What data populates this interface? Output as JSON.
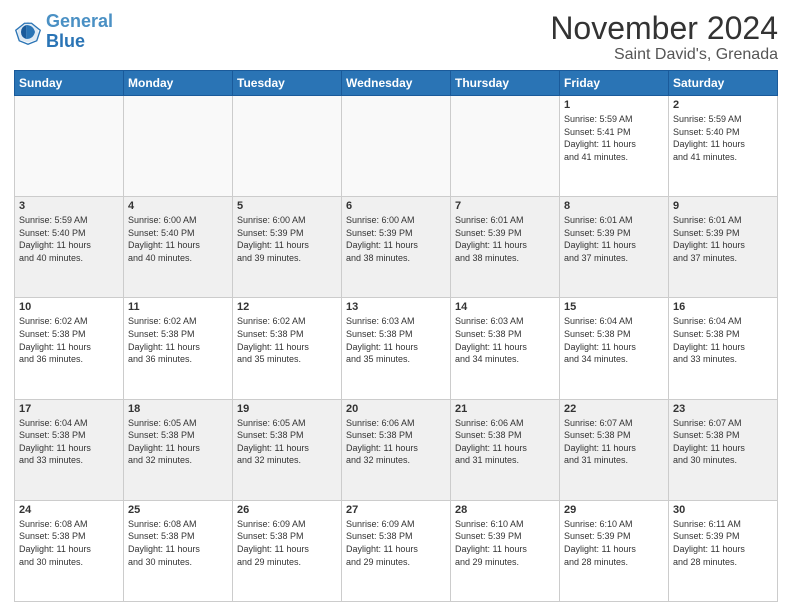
{
  "logo": {
    "line1": "General",
    "line2": "Blue"
  },
  "title": "November 2024",
  "subtitle": "Saint David's, Grenada",
  "weekdays": [
    "Sunday",
    "Monday",
    "Tuesday",
    "Wednesday",
    "Thursday",
    "Friday",
    "Saturday"
  ],
  "weeks": [
    [
      {
        "day": "",
        "info": ""
      },
      {
        "day": "",
        "info": ""
      },
      {
        "day": "",
        "info": ""
      },
      {
        "day": "",
        "info": ""
      },
      {
        "day": "",
        "info": ""
      },
      {
        "day": "1",
        "info": "Sunrise: 5:59 AM\nSunset: 5:41 PM\nDaylight: 11 hours\nand 41 minutes."
      },
      {
        "day": "2",
        "info": "Sunrise: 5:59 AM\nSunset: 5:40 PM\nDaylight: 11 hours\nand 41 minutes."
      }
    ],
    [
      {
        "day": "3",
        "info": "Sunrise: 5:59 AM\nSunset: 5:40 PM\nDaylight: 11 hours\nand 40 minutes."
      },
      {
        "day": "4",
        "info": "Sunrise: 6:00 AM\nSunset: 5:40 PM\nDaylight: 11 hours\nand 40 minutes."
      },
      {
        "day": "5",
        "info": "Sunrise: 6:00 AM\nSunset: 5:39 PM\nDaylight: 11 hours\nand 39 minutes."
      },
      {
        "day": "6",
        "info": "Sunrise: 6:00 AM\nSunset: 5:39 PM\nDaylight: 11 hours\nand 38 minutes."
      },
      {
        "day": "7",
        "info": "Sunrise: 6:01 AM\nSunset: 5:39 PM\nDaylight: 11 hours\nand 38 minutes."
      },
      {
        "day": "8",
        "info": "Sunrise: 6:01 AM\nSunset: 5:39 PM\nDaylight: 11 hours\nand 37 minutes."
      },
      {
        "day": "9",
        "info": "Sunrise: 6:01 AM\nSunset: 5:39 PM\nDaylight: 11 hours\nand 37 minutes."
      }
    ],
    [
      {
        "day": "10",
        "info": "Sunrise: 6:02 AM\nSunset: 5:38 PM\nDaylight: 11 hours\nand 36 minutes."
      },
      {
        "day": "11",
        "info": "Sunrise: 6:02 AM\nSunset: 5:38 PM\nDaylight: 11 hours\nand 36 minutes."
      },
      {
        "day": "12",
        "info": "Sunrise: 6:02 AM\nSunset: 5:38 PM\nDaylight: 11 hours\nand 35 minutes."
      },
      {
        "day": "13",
        "info": "Sunrise: 6:03 AM\nSunset: 5:38 PM\nDaylight: 11 hours\nand 35 minutes."
      },
      {
        "day": "14",
        "info": "Sunrise: 6:03 AM\nSunset: 5:38 PM\nDaylight: 11 hours\nand 34 minutes."
      },
      {
        "day": "15",
        "info": "Sunrise: 6:04 AM\nSunset: 5:38 PM\nDaylight: 11 hours\nand 34 minutes."
      },
      {
        "day": "16",
        "info": "Sunrise: 6:04 AM\nSunset: 5:38 PM\nDaylight: 11 hours\nand 33 minutes."
      }
    ],
    [
      {
        "day": "17",
        "info": "Sunrise: 6:04 AM\nSunset: 5:38 PM\nDaylight: 11 hours\nand 33 minutes."
      },
      {
        "day": "18",
        "info": "Sunrise: 6:05 AM\nSunset: 5:38 PM\nDaylight: 11 hours\nand 32 minutes."
      },
      {
        "day": "19",
        "info": "Sunrise: 6:05 AM\nSunset: 5:38 PM\nDaylight: 11 hours\nand 32 minutes."
      },
      {
        "day": "20",
        "info": "Sunrise: 6:06 AM\nSunset: 5:38 PM\nDaylight: 11 hours\nand 32 minutes."
      },
      {
        "day": "21",
        "info": "Sunrise: 6:06 AM\nSunset: 5:38 PM\nDaylight: 11 hours\nand 31 minutes."
      },
      {
        "day": "22",
        "info": "Sunrise: 6:07 AM\nSunset: 5:38 PM\nDaylight: 11 hours\nand 31 minutes."
      },
      {
        "day": "23",
        "info": "Sunrise: 6:07 AM\nSunset: 5:38 PM\nDaylight: 11 hours\nand 30 minutes."
      }
    ],
    [
      {
        "day": "24",
        "info": "Sunrise: 6:08 AM\nSunset: 5:38 PM\nDaylight: 11 hours\nand 30 minutes."
      },
      {
        "day": "25",
        "info": "Sunrise: 6:08 AM\nSunset: 5:38 PM\nDaylight: 11 hours\nand 30 minutes."
      },
      {
        "day": "26",
        "info": "Sunrise: 6:09 AM\nSunset: 5:38 PM\nDaylight: 11 hours\nand 29 minutes."
      },
      {
        "day": "27",
        "info": "Sunrise: 6:09 AM\nSunset: 5:38 PM\nDaylight: 11 hours\nand 29 minutes."
      },
      {
        "day": "28",
        "info": "Sunrise: 6:10 AM\nSunset: 5:39 PM\nDaylight: 11 hours\nand 29 minutes."
      },
      {
        "day": "29",
        "info": "Sunrise: 6:10 AM\nSunset: 5:39 PM\nDaylight: 11 hours\nand 28 minutes."
      },
      {
        "day": "30",
        "info": "Sunrise: 6:11 AM\nSunset: 5:39 PM\nDaylight: 11 hours\nand 28 minutes."
      }
    ]
  ]
}
